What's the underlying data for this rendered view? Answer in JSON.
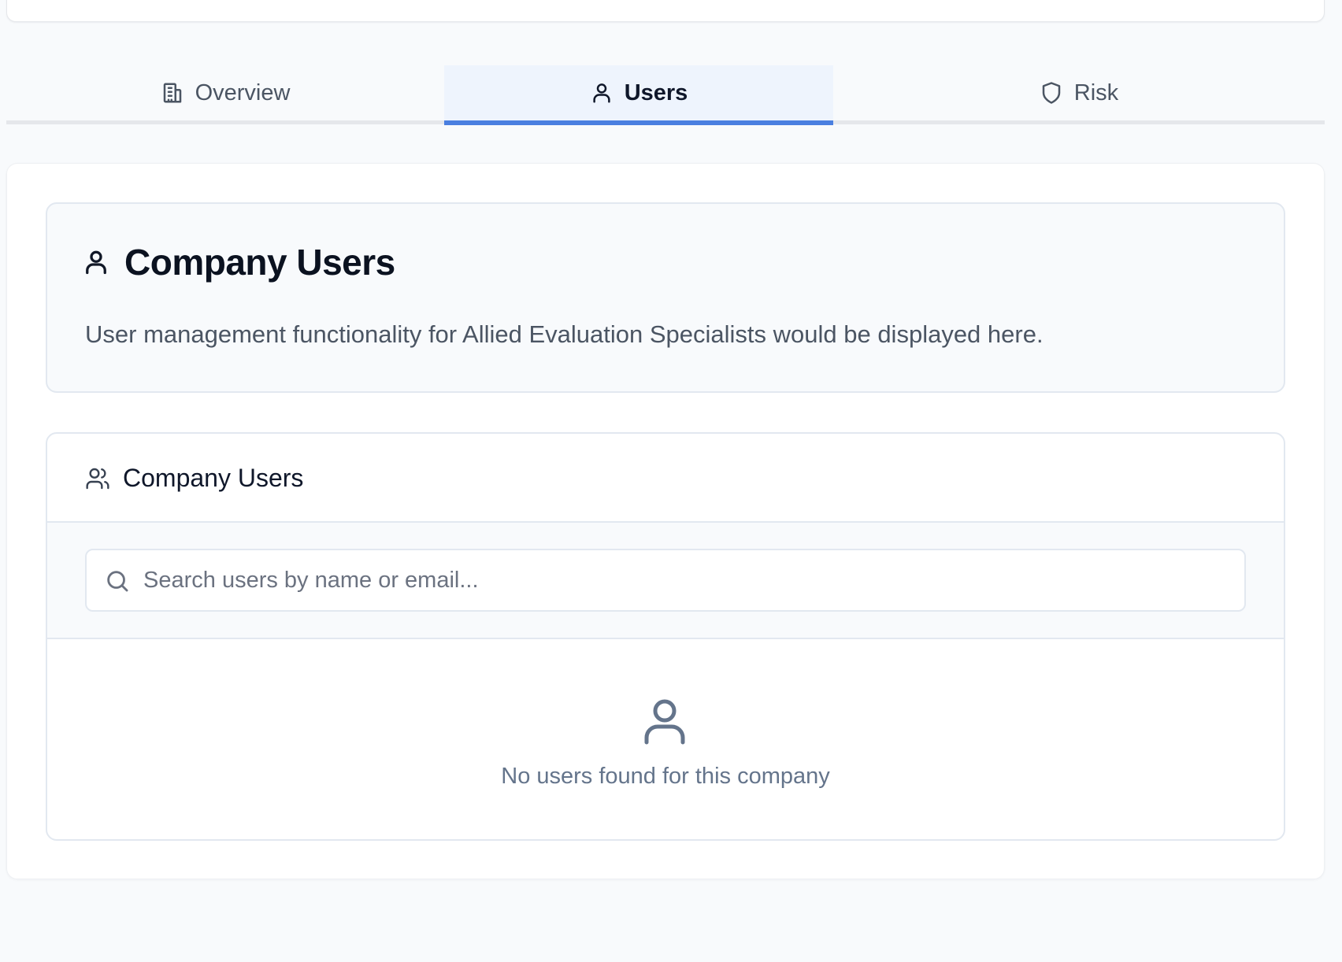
{
  "tabs": [
    {
      "label": "Overview",
      "icon": "building-icon",
      "active": false
    },
    {
      "label": "Users",
      "icon": "user-icon",
      "active": true
    },
    {
      "label": "Risk",
      "icon": "shield-icon",
      "active": false
    }
  ],
  "info_card": {
    "title": "Company Users",
    "description": "User management functionality for Allied Evaluation Specialists would be displayed here."
  },
  "users_panel": {
    "title": "Company Users",
    "search_placeholder": "Search users by name or email...",
    "search_value": "",
    "empty_message": "No users found for this company"
  },
  "colors": {
    "accent": "#4a7fe0",
    "active_tab_bg": "#eef4fd",
    "page_bg": "#f8fafc",
    "muted_text": "#64748b"
  }
}
